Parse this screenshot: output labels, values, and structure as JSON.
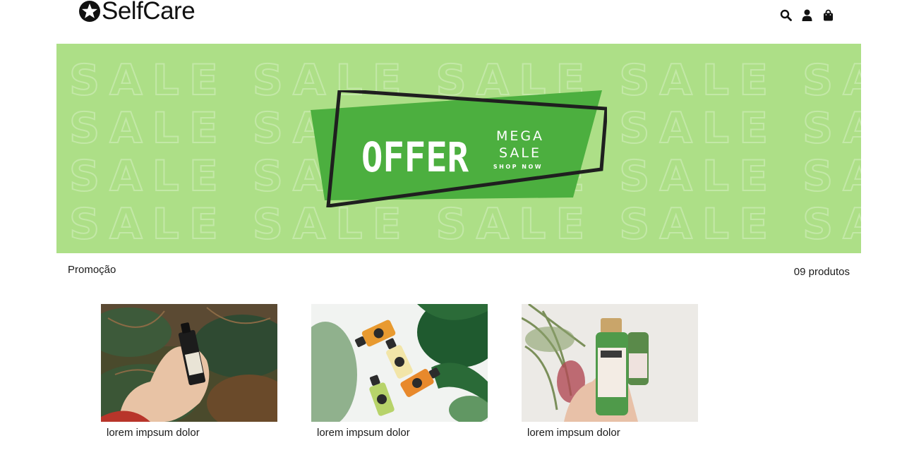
{
  "brand": {
    "name": "SelfCare",
    "logo_icon": "star-circle-icon"
  },
  "header": {
    "icons": [
      {
        "name": "search-icon"
      },
      {
        "name": "user-icon"
      },
      {
        "name": "shopping-bag-icon"
      }
    ]
  },
  "banner": {
    "headline": "OFFER",
    "line1": "MEGA",
    "line2": "SALE",
    "cta": "SHOP NOW",
    "watermark_word": "SALE",
    "colors": {
      "background": "#addf87",
      "card": "#4caf3f",
      "frame": "#1f1f1f",
      "text": "#ffffff"
    }
  },
  "section": {
    "title": "Promoção",
    "count": "09 produtos"
  },
  "products": [
    {
      "name": "lorem impsum dolor",
      "image": "serum-bottle-in-hand-photo"
    },
    {
      "name": "lorem impsum dolor",
      "image": "juice-bottles-with-leaves-photo"
    },
    {
      "name": "lorem impsum dolor",
      "image": "green-shampoo-bottle-photo"
    }
  ]
}
